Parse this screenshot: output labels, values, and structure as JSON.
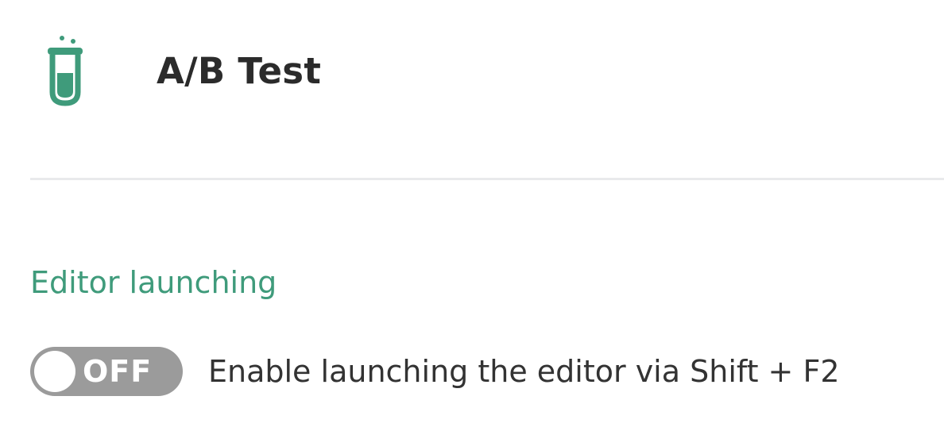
{
  "header": {
    "icon": "flask-icon",
    "title": "A/B Test"
  },
  "sections": [
    {
      "title": "Editor launching",
      "settings": [
        {
          "toggle_state": "OFF",
          "enabled": false,
          "label": "Enable launching the editor via Shift + F2"
        }
      ]
    }
  ],
  "colors": {
    "accent": "#3f9b7b",
    "toggle_off": "#9b9b9b",
    "title_text": "#2b2b2b",
    "body_text": "#333333",
    "divider": "#e9eaec"
  }
}
